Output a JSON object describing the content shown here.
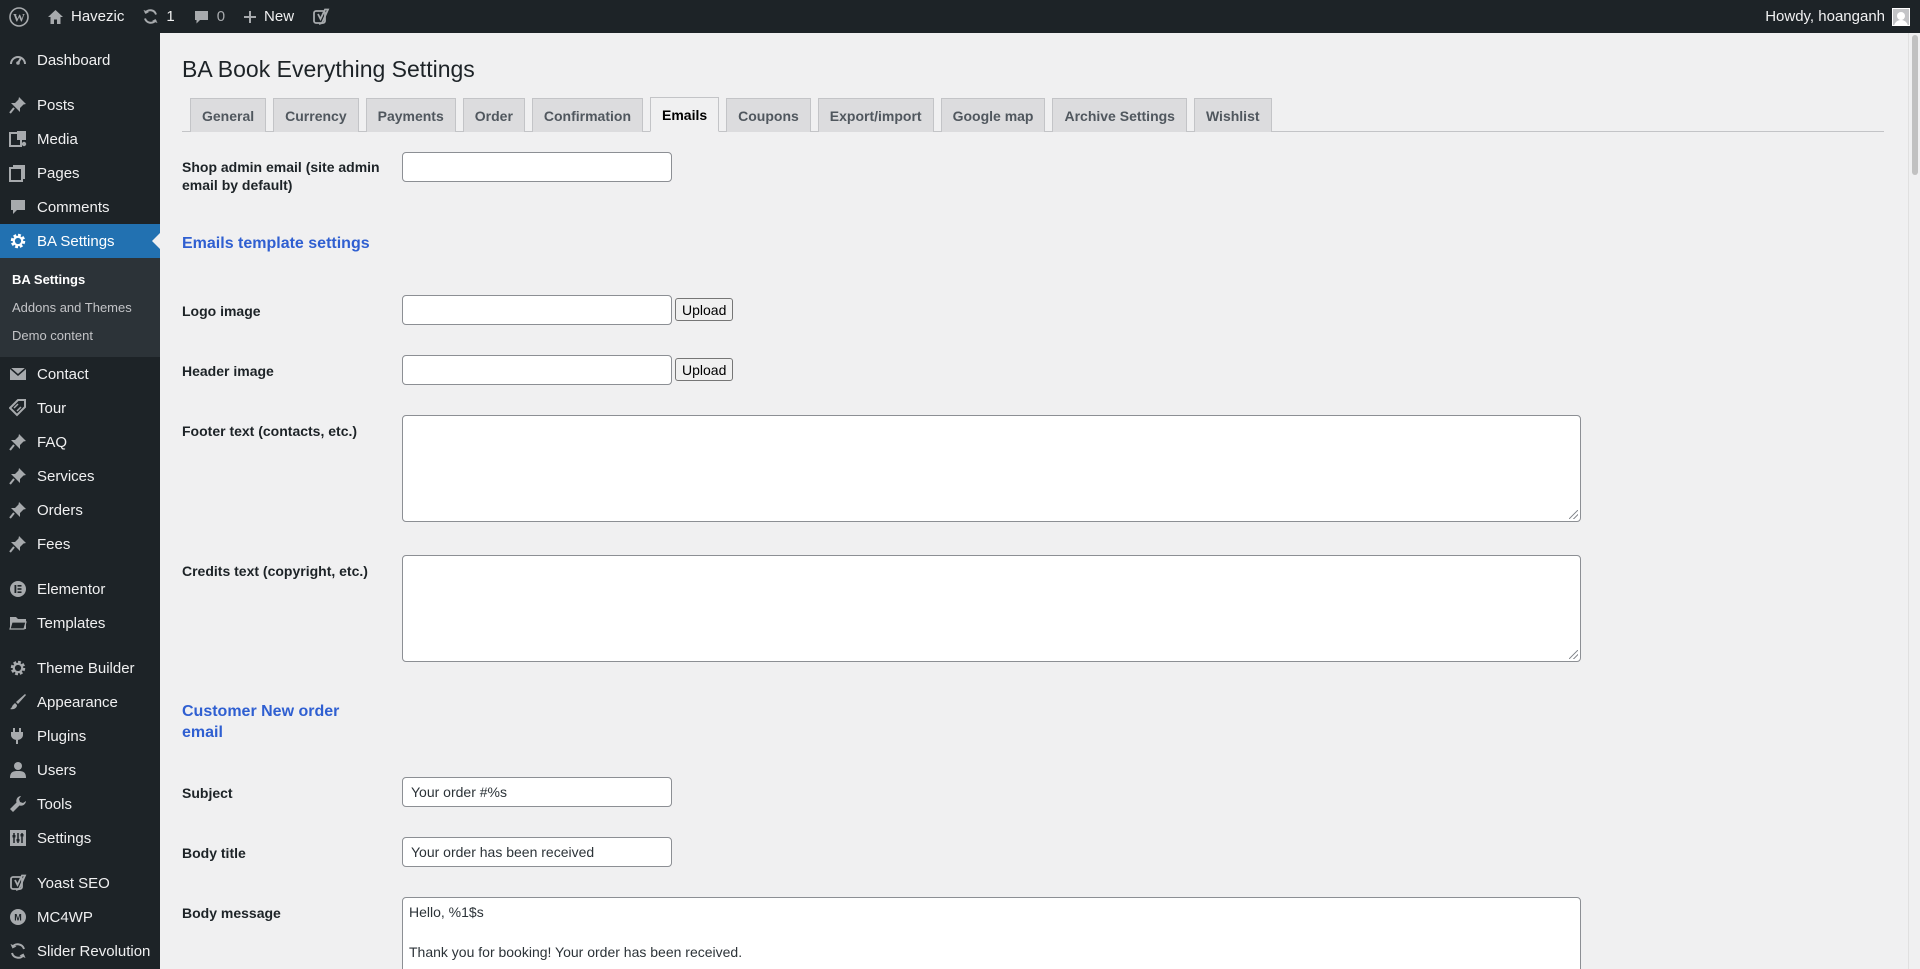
{
  "adminbar": {
    "site_name": "Havezic",
    "updates_count": "1",
    "comments_count": "0",
    "new_label": "New",
    "howdy": "Howdy, hoanganh"
  },
  "sidebar": {
    "dashboard": "Dashboard",
    "posts": "Posts",
    "media": "Media",
    "pages": "Pages",
    "comments": "Comments",
    "ba_settings": "BA Settings",
    "sub": [
      "BA Settings",
      "Addons and Themes",
      "Demo content"
    ],
    "contact": "Contact",
    "tour": "Tour",
    "faq": "FAQ",
    "services": "Services",
    "orders": "Orders",
    "fees": "Fees",
    "elementor": "Elementor",
    "templates": "Templates",
    "theme_builder": "Theme Builder",
    "appearance": "Appearance",
    "plugins": "Plugins",
    "users": "Users",
    "tools": "Tools",
    "settings": "Settings",
    "yoast": "Yoast SEO",
    "mc4wp": "MC4WP",
    "slider": "Slider Revolution"
  },
  "page": {
    "title": "BA Book Everything Settings",
    "tabs": [
      "General",
      "Currency",
      "Payments",
      "Order",
      "Confirmation",
      "Emails",
      "Coupons",
      "Export/import",
      "Google map",
      "Archive Settings",
      "Wishlist"
    ],
    "shop_admin_email_label": "Shop admin email (site admin email by default)",
    "shop_admin_email_value": "",
    "emails_template_title": "Emails template settings",
    "logo_label": "Logo image",
    "header_label": "Header image",
    "upload_label": "Upload",
    "footer_label": "Footer text (contacts, etc.)",
    "credits_label": "Credits text (copyright, etc.)",
    "customer_new_order_title": "Customer New order email",
    "subject_label": "Subject",
    "subject_value": "Your order #%s",
    "body_title_label": "Body title",
    "body_title_value": "Your order has been received",
    "body_message_label": "Body message",
    "body_message_line1": "Hello, %1$s",
    "body_message_line2": "Thank you for booking! Your order has been received."
  }
}
